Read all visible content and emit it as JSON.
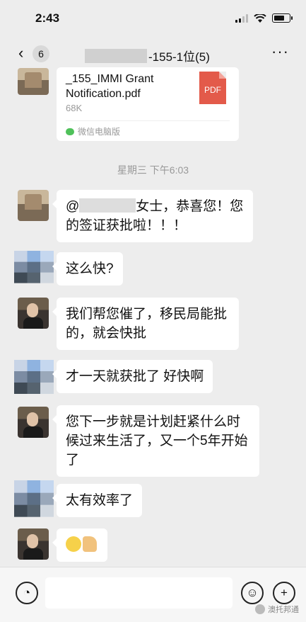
{
  "status_bar": {
    "time": "2:43"
  },
  "nav": {
    "back_count": "6",
    "title_suffix": "-155-1位(5)",
    "more": "···"
  },
  "file_message": {
    "name": "_155_IMMI Grant Notification.pdf",
    "size": "68K",
    "icon_label": "PDF",
    "source": "微信电脑版"
  },
  "timestamp": "星期三 下午6:03",
  "messages": [
    {
      "sender": "agent_photo",
      "prefix": "@",
      "text": "女士，恭喜您！您的签证获批啦！！！"
    },
    {
      "sender": "client",
      "text": "这么快?"
    },
    {
      "sender": "agent",
      "text": "我们帮您催了，移民局能批的，就会快批"
    },
    {
      "sender": "client",
      "text": "才一天就获批了 好快啊"
    },
    {
      "sender": "agent",
      "text": "您下一步就是计划赶紧什么时候过来生活了，又一个5年开始了"
    },
    {
      "sender": "client",
      "text": "太有效率了"
    },
    {
      "sender": "agent",
      "emoji": [
        "smile-emoji",
        "thumbs-up-emoji"
      ]
    }
  ],
  "watermark": "澳托邦通"
}
